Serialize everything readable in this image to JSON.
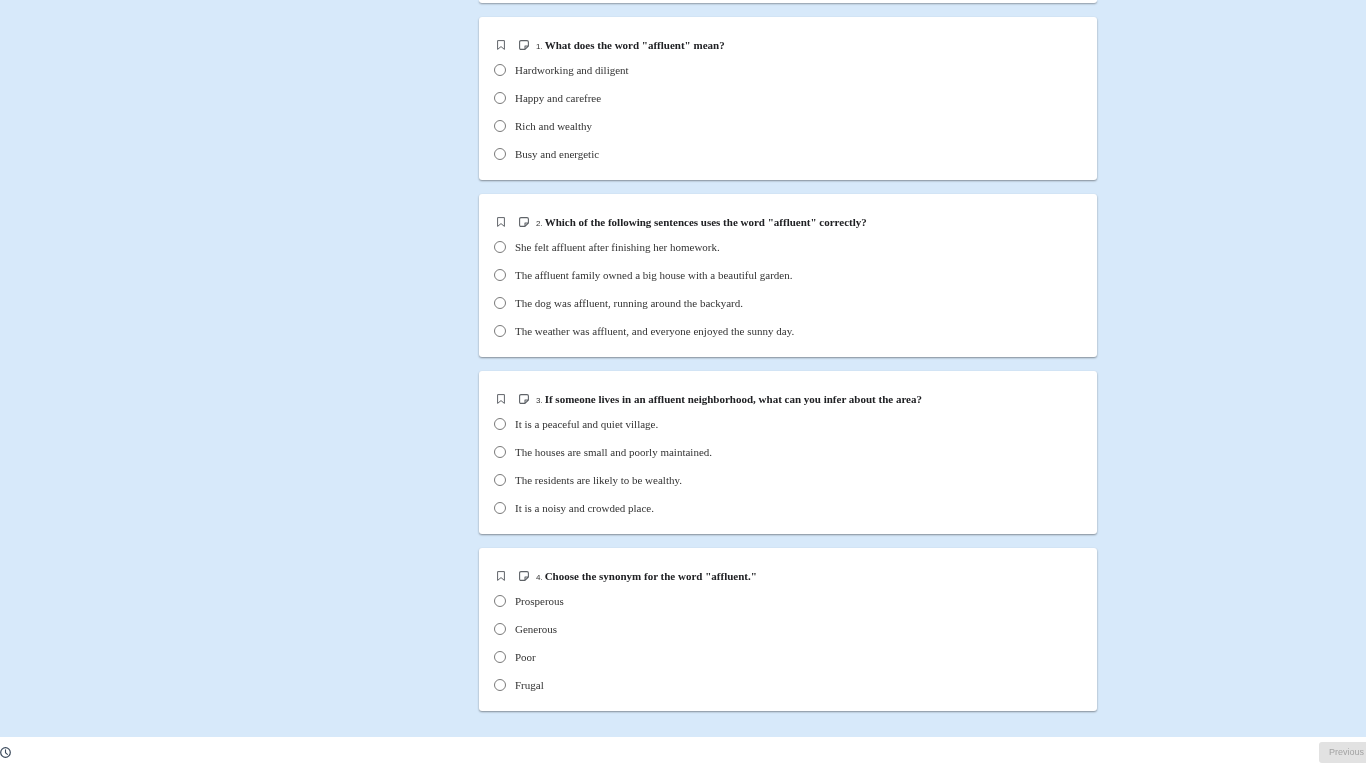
{
  "questions": [
    {
      "number": "1.",
      "text": "What does the word \"affluent\" mean?",
      "bookmarked": false,
      "options": [
        {
          "label": "Hardworking and diligent",
          "selected": false
        },
        {
          "label": "Happy and carefree",
          "selected": false
        },
        {
          "label": "Rich and wealthy",
          "selected": false
        },
        {
          "label": "Busy and energetic",
          "selected": false
        }
      ]
    },
    {
      "number": "2.",
      "text": "Which of the following sentences uses the word \"affluent\" correctly?",
      "bookmarked": false,
      "options": [
        {
          "label": "She felt affluent after finishing her homework.",
          "selected": false
        },
        {
          "label": "The affluent family owned a big house with a beautiful garden.",
          "selected": false
        },
        {
          "label": "The dog was affluent, running around the backyard.",
          "selected": false
        },
        {
          "label": "The weather was affluent, and everyone enjoyed the sunny day.",
          "selected": false
        }
      ]
    },
    {
      "number": "3.",
      "text": "If someone lives in an affluent neighborhood, what can you infer about the area?",
      "bookmarked": false,
      "options": [
        {
          "label": "It is a peaceful and quiet village.",
          "selected": false
        },
        {
          "label": "The houses are small and poorly maintained.",
          "selected": false
        },
        {
          "label": "The residents are likely to be wealthy.",
          "selected": false
        },
        {
          "label": "It is a noisy and crowded place.",
          "selected": false
        }
      ]
    },
    {
      "number": "4.",
      "text": "Choose the synonym for the word \"affluent.\"",
      "bookmarked": false,
      "options": [
        {
          "label": "Prosperous",
          "selected": false
        },
        {
          "label": "Generous",
          "selected": false
        },
        {
          "label": "Poor",
          "selected": false
        },
        {
          "label": "Frugal",
          "selected": false
        }
      ]
    }
  ],
  "footer": {
    "previous_button": {
      "label": "Previous",
      "disabled": true
    }
  }
}
